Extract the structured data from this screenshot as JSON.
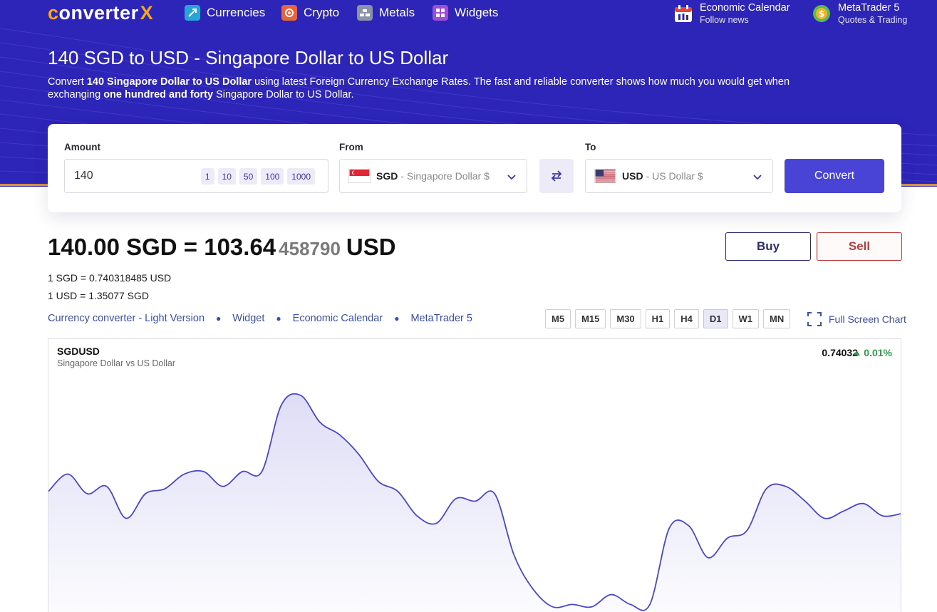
{
  "colors": {
    "hero_bg": "#2d24b8",
    "accent": "#4a44d6",
    "logo_accent": "#f5a623",
    "buy": "#2e2a72",
    "sell": "#b83a3a",
    "positive": "#2a9d4a",
    "chart_line": "#4a47c6"
  },
  "header": {
    "logo_text": {
      "c": "c",
      "middle": "onverter",
      "x": "X"
    },
    "nav": [
      {
        "label": "Currencies",
        "icon": "currencies-icon"
      },
      {
        "label": "Crypto",
        "icon": "crypto-icon"
      },
      {
        "label": "Metals",
        "icon": "metals-icon"
      },
      {
        "label": "Widgets",
        "icon": "widgets-icon"
      }
    ],
    "right_links": [
      {
        "title": "Economic Calendar",
        "subtitle": "Follow news",
        "icon": "calendar-icon"
      },
      {
        "title": "MetaTrader 5",
        "subtitle": "Quotes & Trading",
        "icon": "metatrader-icon"
      }
    ]
  },
  "page": {
    "title": "140 SGD to USD - Singapore Dollar to US Dollar",
    "intro": {
      "p1": "Convert ",
      "b1": "140 Singapore Dollar to US Dollar",
      "p2": " using latest Foreign Currency Exchange Rates. The fast and reliable converter shows how much you would get when exchanging ",
      "b2": "one hundred and forty",
      "p3": " Singapore Dollar to US Dollar."
    }
  },
  "converter": {
    "amount_label": "Amount",
    "amount_value": "140",
    "quick_amounts": [
      "1",
      "10",
      "50",
      "100",
      "1000"
    ],
    "from_label": "From",
    "from_code": "SGD",
    "from_name": "- Singapore Dollar $",
    "to_label": "To",
    "to_code": "USD",
    "to_name": "- US Dollar $",
    "convert_label": "Convert"
  },
  "result": {
    "main": "140.00 SGD = 103.64",
    "faded": "458790",
    "currency": "USD",
    "rate1": "1 SGD  =  0.740318485 USD",
    "rate2": "1 USD  =  1.35077 SGD",
    "buy_label": "Buy",
    "sell_label": "Sell"
  },
  "links": [
    "Currency converter - Light Version",
    "Widget",
    "Economic Calendar",
    "MetaTrader 5"
  ],
  "timeframes": {
    "items": [
      "M5",
      "M15",
      "M30",
      "H1",
      "H4",
      "D1",
      "W1",
      "MN"
    ],
    "active": "D1"
  },
  "fullscreen_label": "Full Screen Chart",
  "chart_data": {
    "type": "area",
    "symbol": "SGDUSD",
    "subtitle": "Singapore Dollar vs US Dollar",
    "last_price": "0.74032",
    "change": "0.01%",
    "trend": "up",
    "values": [
      0.7402,
      0.7409,
      0.7401,
      0.7404,
      0.7391,
      0.7401,
      0.7403,
      0.7409,
      0.741,
      0.7404,
      0.741,
      0.741,
      0.7437,
      0.7441,
      0.743,
      0.7425,
      0.7417,
      0.7406,
      0.7402,
      0.7392,
      0.7389,
      0.7399,
      0.7398,
      0.7401,
      0.7376,
      0.7362,
      0.7355,
      0.7356,
      0.7355,
      0.736,
      0.7356,
      0.7356,
      0.7387,
      0.7388,
      0.7375,
      0.7383,
      0.7386,
      0.7403,
      0.7404,
      0.7398,
      0.7391,
      0.7394,
      0.7397,
      0.7392,
      0.7393
    ]
  }
}
